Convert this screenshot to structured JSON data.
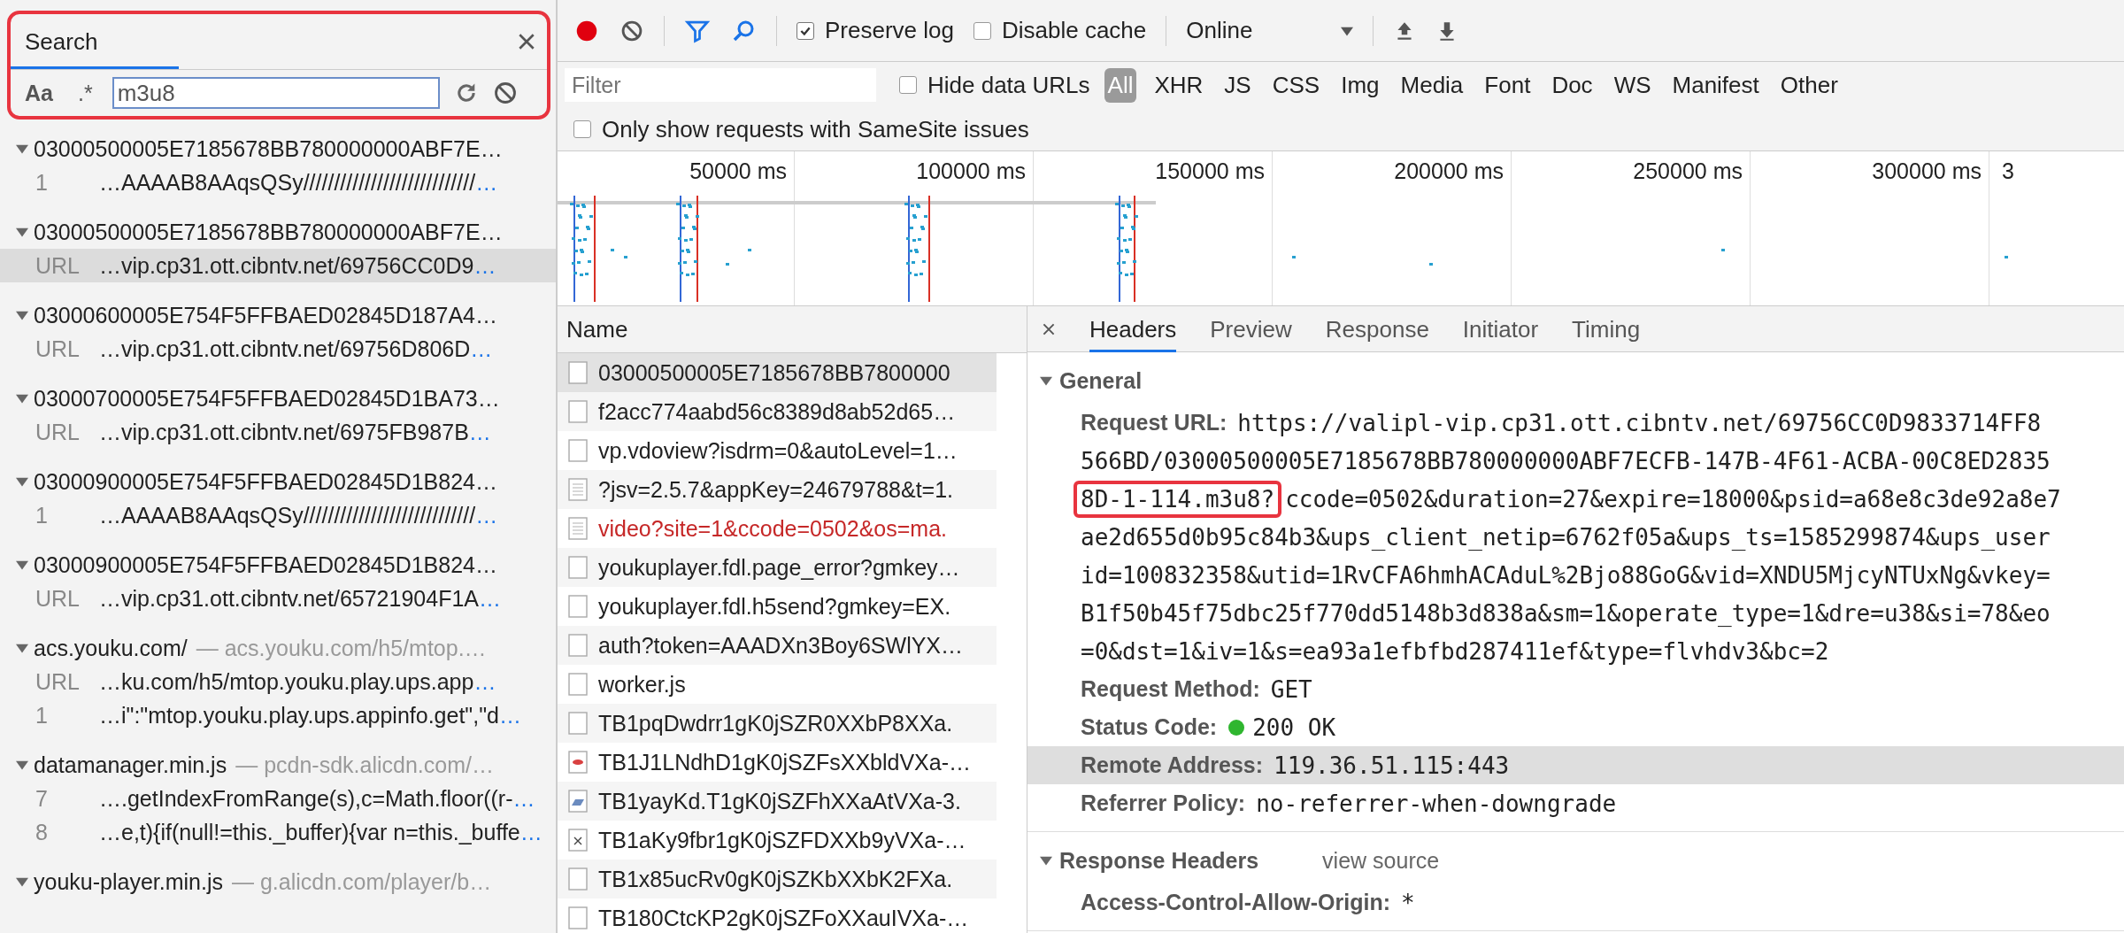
{
  "search_panel": {
    "tab": "Search",
    "annotated": true,
    "case_toggle": "Aa",
    "regex_toggle": ".*",
    "query": "m3u8",
    "results": [
      {
        "title": "03000500005E7185678BB780000000ABF7E…",
        "matches": [
          {
            "line": "1",
            "text": "…AAAAB8AAqsQSy////////////////////////////",
            "tail": "…",
            "selected": false
          }
        ]
      },
      {
        "title": "03000500005E7185678BB780000000ABF7E…",
        "matches": [
          {
            "line": "URL",
            "text": "…vip.cp31.ott.cibntv.net/69756CC0D9",
            "tail": "…",
            "selected": true
          }
        ]
      },
      {
        "title": "03000600005E754F5FFBAED02845D187A4…",
        "matches": [
          {
            "line": "URL",
            "text": "…vip.cp31.ott.cibntv.net/69756D806D",
            "tail": "…",
            "selected": false
          }
        ]
      },
      {
        "title": "03000700005E754F5FFBAED02845D1BA73…",
        "matches": [
          {
            "line": "URL",
            "text": "…vip.cp31.ott.cibntv.net/6975FB987B",
            "tail": "…",
            "selected": false
          }
        ]
      },
      {
        "title": "03000900005E754F5FFBAED02845D1B824…",
        "matches": [
          {
            "line": "1",
            "text": "…AAAAB8AAqsQSy////////////////////////////",
            "tail": "…",
            "selected": false
          }
        ]
      },
      {
        "title": "03000900005E754F5FFBAED02845D1B824…",
        "matches": [
          {
            "line": "URL",
            "text": "…vip.cp31.ott.cibntv.net/65721904F1A",
            "tail": "…",
            "selected": false
          }
        ]
      },
      {
        "title": "acs.youku.com/",
        "source": "— acs.youku.com/h5/mtop.…",
        "matches": [
          {
            "line": "URL",
            "text": "…ku.com/h5/mtop.youku.play.ups.app",
            "tail": "…",
            "selected": false
          },
          {
            "line": "1",
            "text": "…i\":\"mtop.youku.play.ups.appinfo.get\",\"d",
            "tail": "…",
            "selected": false
          }
        ]
      },
      {
        "title": "datamanager.min.js",
        "source": "— pcdn-sdk.alicdn.com/…",
        "matches": [
          {
            "line": "7",
            "text": "….getIndexFromRange(s),c=Math.floor((r-",
            "tail": "…",
            "selected": false
          },
          {
            "line": "8",
            "text": "…e,t){if(null!=this._buffer){var n=this._buffe",
            "tail": "…",
            "selected": false
          }
        ]
      },
      {
        "title": "youku-player.min.js",
        "source": "— g.alicdn.com/player/b…"
      }
    ]
  },
  "toolbar": {
    "preserve_log": {
      "label": "Preserve log",
      "checked": true
    },
    "disable_cache": {
      "label": "Disable cache",
      "checked": false
    },
    "throttling": "Online"
  },
  "filter_bar": {
    "placeholder": "Filter",
    "hide_data_urls": {
      "label": "Hide data URLs",
      "checked": false
    },
    "types": [
      {
        "label": "All",
        "selected": true
      },
      {
        "label": "XHR",
        "selected": false
      },
      {
        "label": "JS",
        "selected": false
      },
      {
        "label": "CSS",
        "selected": false
      },
      {
        "label": "Img",
        "selected": false
      },
      {
        "label": "Media",
        "selected": false
      },
      {
        "label": "Font",
        "selected": false
      },
      {
        "label": "Doc",
        "selected": false
      },
      {
        "label": "WS",
        "selected": false
      },
      {
        "label": "Manifest",
        "selected": false
      },
      {
        "label": "Other",
        "selected": false
      }
    ]
  },
  "samesite_filter": {
    "label": "Only show requests with SameSite issues",
    "checked": false
  },
  "timeline": {
    "ticks": [
      "50000 ms",
      "100000 ms",
      "150000 ms",
      "200000 ms",
      "250000 ms",
      "300000 ms",
      "3"
    ]
  },
  "requests": {
    "column": "Name",
    "rows": [
      {
        "name": "03000500005E7185678BB7800000",
        "kind": "plain",
        "error": false,
        "selected": true
      },
      {
        "name": "f2acc774aabd56c8389d8ab52d65…",
        "kind": "plain",
        "error": false,
        "selected": false
      },
      {
        "name": "vp.vdoview?isdrm=0&autoLevel=1…",
        "kind": "plain",
        "error": false,
        "selected": false
      },
      {
        "name": "?jsv=2.5.7&appKey=24679788&t=1.",
        "kind": "text",
        "error": false,
        "selected": false
      },
      {
        "name": "video?site=1&ccode=0502&os=ma.",
        "kind": "text",
        "error": true,
        "selected": false
      },
      {
        "name": "youkuplayer.fdl.page_error?gmkey…",
        "kind": "plain",
        "error": false,
        "selected": false
      },
      {
        "name": "youkuplayer.fdl.h5send?gmkey=EX.",
        "kind": "plain",
        "error": false,
        "selected": false
      },
      {
        "name": "auth?token=AAADXn3Boy6SWlYX…",
        "kind": "plain",
        "error": false,
        "selected": false
      },
      {
        "name": "worker.js",
        "kind": "plain",
        "error": false,
        "selected": false
      },
      {
        "name": "TB1pqDwdrr1gK0jSZR0XXbP8XXa.",
        "kind": "plain",
        "error": false,
        "selected": false
      },
      {
        "name": "TB1J1LNdhD1gK0jSZFsXXbldVXa-…",
        "kind": "image",
        "error": false,
        "selected": false
      },
      {
        "name": "TB1yayKd.T1gK0jSZFhXXaAtVXa-3.",
        "kind": "photo",
        "error": false,
        "selected": false
      },
      {
        "name": "TB1aKy9fbr1gK0jSZFDXXb9yVXa-…",
        "kind": "broken",
        "error": false,
        "selected": false
      },
      {
        "name": "TB1x85ucRv0gK0jSZKbXXbK2FXa.",
        "kind": "plain",
        "error": false,
        "selected": false
      },
      {
        "name": "TB180CtcKP2gK0jSZFoXXauIVXa-…",
        "kind": "plain",
        "error": false,
        "selected": false
      }
    ]
  },
  "details": {
    "tabs": [
      {
        "label": "Headers",
        "selected": true
      },
      {
        "label": "Preview",
        "selected": false
      },
      {
        "label": "Response",
        "selected": false
      },
      {
        "label": "Initiator",
        "selected": false
      },
      {
        "label": "Timing",
        "selected": false
      }
    ],
    "sections": [
      {
        "title": "General",
        "expanded": true,
        "entries": [
          {
            "kind": "multiline",
            "label": "Request URL:",
            "highlighted": false,
            "lines": [
              [
                {
                  "text": "https://valipl-vip.cp31.ott.cibntv.net/69756CC0D9833714FF8",
                  "marked": false
                }
              ],
              [
                {
                  "text": "566BD/03000500005E7185678BB780000000ABF7ECFB-147B-4F61-ACBA-00C8ED2835",
                  "marked": false
                }
              ],
              [
                {
                  "text": "8D-1-114.m3u8?",
                  "marked": true
                },
                {
                  "text": "ccode=0502&duration=27&expire=18000&psid=a68e8c3de92a8e7",
                  "marked": false
                }
              ],
              [
                {
                  "text": "ae2d655d0b95c84b3&ups_client_netip=6762f05a&ups_ts=1585299874&ups_user",
                  "marked": false
                }
              ],
              [
                {
                  "text": "id=100832358&utid=1RvCFA6hmhACAduL%2Bjo88GoG&vid=XNDU5MjcyNTUxNg&vkey=",
                  "marked": false
                }
              ],
              [
                {
                  "text": "B1f50b45f75dbc25f770dd5148b3d838a&sm=1&operate_type=1&dre=u38&si=78&eo",
                  "marked": false
                }
              ],
              [
                {
                  "text": "=0&dst=1&iv=1&s=ea93a1efbfbd287411ef&type=flvhdv3&bc=2",
                  "marked": false
                }
              ]
            ]
          },
          {
            "kind": "plain",
            "label": "Request Method:",
            "value": "GET",
            "highlighted": false
          },
          {
            "kind": "status",
            "label": "Status Code:",
            "value": "200 OK",
            "highlighted": false
          },
          {
            "kind": "plain",
            "label": "Remote Address:",
            "value": "119.36.51.115:443",
            "highlighted": true
          },
          {
            "kind": "plain",
            "label": "Referrer Policy:",
            "value": "no-referrer-when-downgrade",
            "highlighted": false
          }
        ]
      },
      {
        "title": "Response Headers",
        "expanded": true,
        "link": "view source",
        "entries": [
          {
            "kind": "plain",
            "label": "Access-Control-Allow-Origin:",
            "value": "*",
            "highlighted": false
          }
        ]
      }
    ]
  }
}
